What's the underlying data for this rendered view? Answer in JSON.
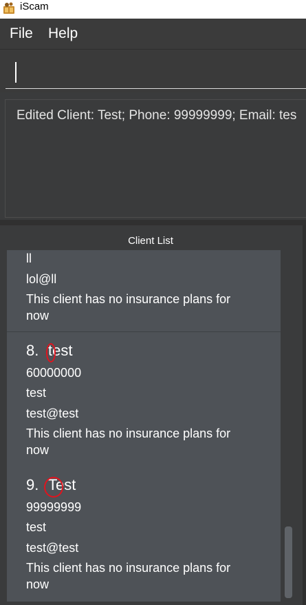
{
  "window": {
    "title": "iScam"
  },
  "menu": {
    "file": "File",
    "help": "Help"
  },
  "command_input": {
    "value": ""
  },
  "result": {
    "text": "Edited Client: Test; Phone: 99999999; Email: tes"
  },
  "client_list": {
    "title": "Client List",
    "partial": {
      "address": "ll",
      "email": "lol@ll",
      "plans_line1": "This client has no insurance plans for",
      "plans_line2": "now"
    },
    "client8": {
      "index": "8.",
      "name": "test",
      "phone": "60000000",
      "address": "test",
      "email": "test@test",
      "plans_line1": "This client has no insurance plans for",
      "plans_line2": "now"
    },
    "client9": {
      "index": "9.",
      "name": "Test",
      "phone": "99999999",
      "address": "test",
      "email": "test@test",
      "plans_line1": "This client has no insurance plans for",
      "plans_line2": "now"
    }
  },
  "colors": {
    "annotation": "#e0141e",
    "list_bg": "#4e5257",
    "window_bg": "#3a3b3c"
  }
}
